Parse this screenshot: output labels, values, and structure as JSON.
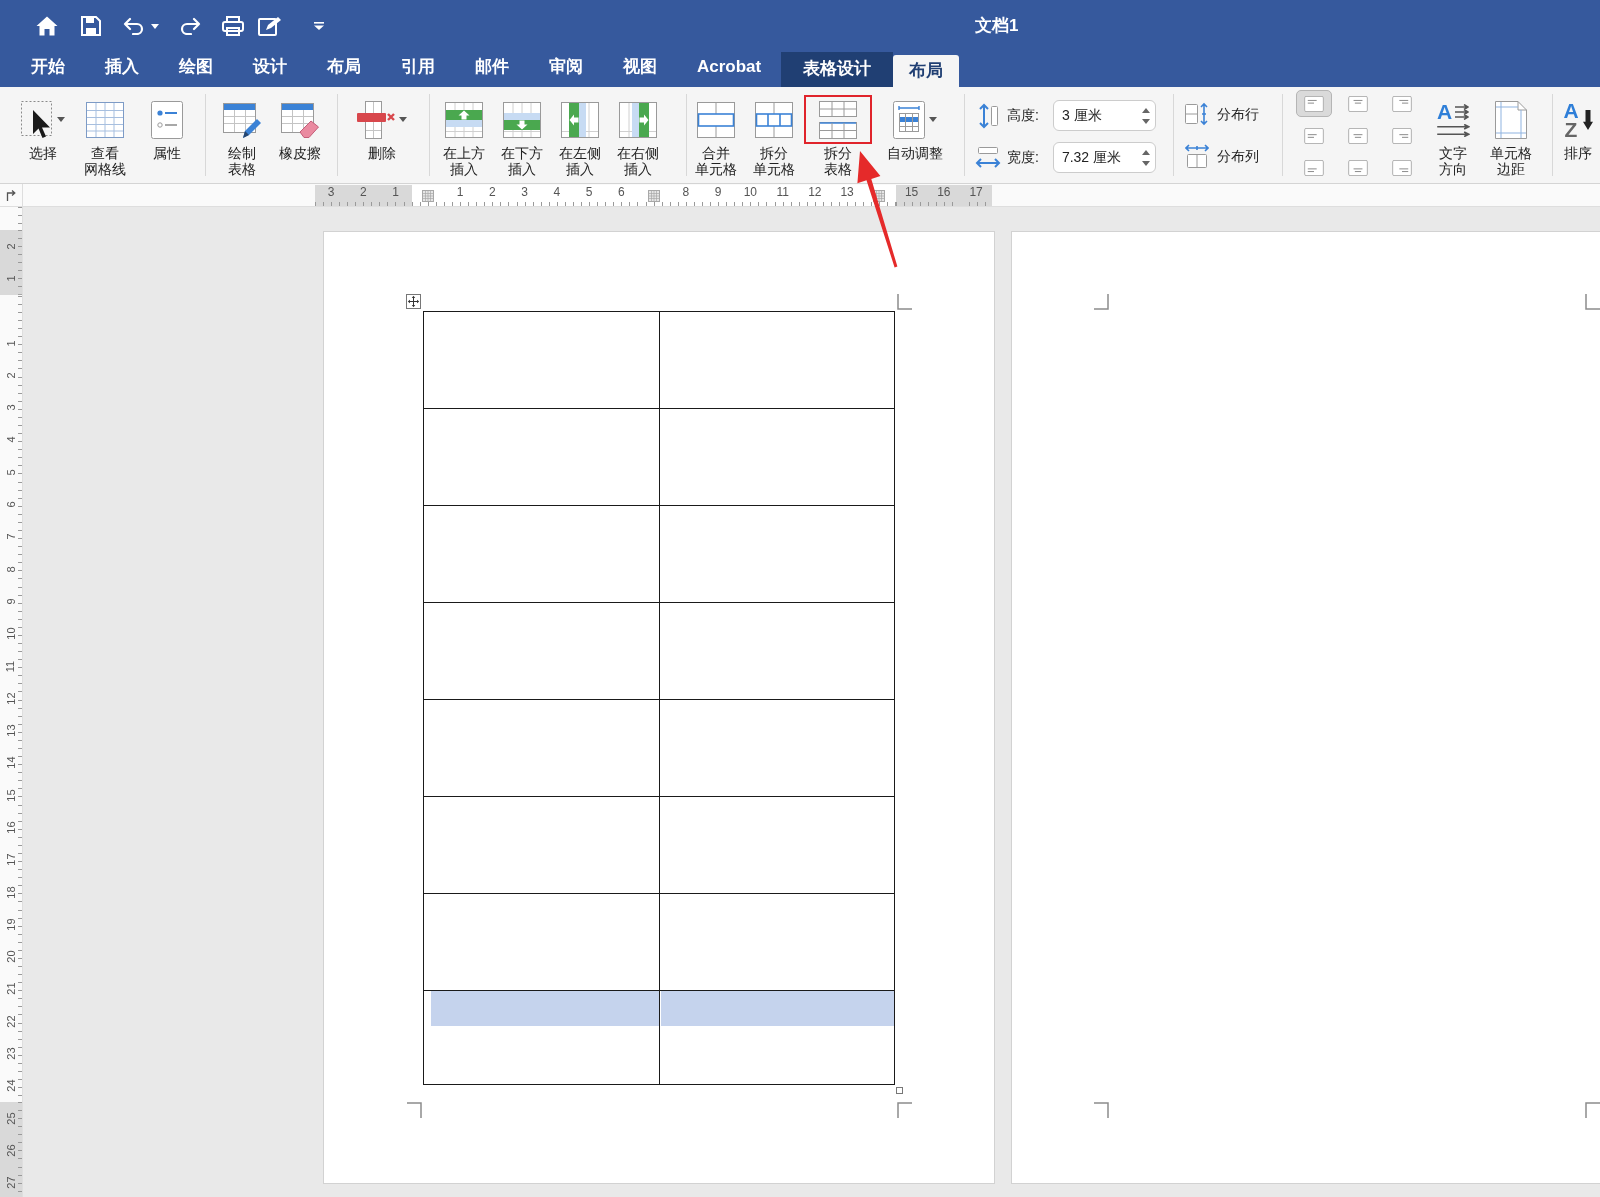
{
  "window": {
    "title": "文档1"
  },
  "tabs": [
    {
      "label": "开始",
      "selected": false,
      "contextual": false
    },
    {
      "label": "插入",
      "selected": false,
      "contextual": false
    },
    {
      "label": "绘图",
      "selected": false,
      "contextual": false
    },
    {
      "label": "设计",
      "selected": false,
      "contextual": false
    },
    {
      "label": "布局",
      "selected": false,
      "contextual": false
    },
    {
      "label": "引用",
      "selected": false,
      "contextual": false
    },
    {
      "label": "邮件",
      "selected": false,
      "contextual": false
    },
    {
      "label": "审阅",
      "selected": false,
      "contextual": false
    },
    {
      "label": "视图",
      "selected": false,
      "contextual": false
    },
    {
      "label": "Acrobat",
      "selected": false,
      "contextual": false
    },
    {
      "label": "表格设计",
      "selected": false,
      "contextual": true
    },
    {
      "label": "布局",
      "selected": true,
      "contextual": true
    }
  ],
  "ribbon": {
    "groups": [
      {
        "items": [
          {
            "kind": "button",
            "label": "选择",
            "dropdown": true,
            "highlighted": false
          },
          {
            "kind": "button",
            "label": "查看网格线",
            "dropdown": false,
            "highlighted": false
          },
          {
            "kind": "button",
            "label": "属性",
            "dropdown": false,
            "highlighted": false
          }
        ]
      },
      {
        "items": [
          {
            "kind": "button",
            "label": "绘制表格",
            "dropdown": false,
            "highlighted": false
          },
          {
            "kind": "button",
            "label": "橡皮擦",
            "dropdown": false,
            "highlighted": false
          }
        ]
      },
      {
        "items": [
          {
            "kind": "button",
            "label": "删除",
            "dropdown": true,
            "highlighted": false
          }
        ]
      },
      {
        "items": [
          {
            "kind": "button",
            "label": "在上方插入",
            "dropdown": false,
            "highlighted": false
          },
          {
            "kind": "button",
            "label": "在下方插入",
            "dropdown": false,
            "highlighted": false
          },
          {
            "kind": "button",
            "label": "在左侧插入",
            "dropdown": false,
            "highlighted": false
          },
          {
            "kind": "button",
            "label": "在右侧插入",
            "dropdown": false,
            "highlighted": false
          }
        ]
      },
      {
        "items": [
          {
            "kind": "button",
            "label": "合并单元格",
            "dropdown": false,
            "highlighted": false
          },
          {
            "kind": "button",
            "label": "拆分单元格",
            "dropdown": false,
            "highlighted": false
          },
          {
            "kind": "button",
            "label": "拆分表格",
            "dropdown": false,
            "highlighted": true
          },
          {
            "kind": "button",
            "label": "自动调整",
            "dropdown": true,
            "highlighted": false
          }
        ]
      },
      {
        "items": [
          {
            "kind": "spinner",
            "label": "高度:",
            "value": "3 厘米"
          },
          {
            "kind": "spinner",
            "label": "宽度:",
            "value": "7.32 厘米"
          }
        ]
      },
      {
        "items": [
          {
            "kind": "small",
            "label": "分布行"
          },
          {
            "kind": "small",
            "label": "分布列"
          }
        ]
      },
      {
        "items": [
          {
            "kind": "align_grid",
            "cells": [
              {
                "selected": true
              },
              {
                "selected": false
              },
              {
                "selected": false
              },
              {
                "selected": false
              },
              {
                "selected": false
              },
              {
                "selected": false
              },
              {
                "selected": false
              },
              {
                "selected": false
              },
              {
                "selected": false
              }
            ]
          },
          {
            "kind": "button",
            "label": "文字方向",
            "glyphs": [
              "A"
            ],
            "dropdown": false,
            "highlighted": false
          },
          {
            "kind": "button",
            "label": "单元格边距",
            "dropdown": false,
            "highlighted": false
          }
        ]
      },
      {
        "items": [
          {
            "kind": "button",
            "label": "排序",
            "glyphs": [
              "A",
              "Z"
            ],
            "dropdown": false,
            "highlighted": false
          }
        ]
      }
    ]
  },
  "rulers": {
    "horizontal": [
      {
        "kind": "margin",
        "labels": [
          "3",
          "2",
          "1"
        ]
      },
      {
        "kind": "marker"
      },
      {
        "kind": "text",
        "labels": [
          "1",
          "2",
          "3",
          "4",
          "5",
          "6"
        ]
      },
      {
        "kind": "marker"
      },
      {
        "kind": "text",
        "labels": [
          "8",
          "9",
          "10",
          "11",
          "12",
          "13"
        ]
      },
      {
        "kind": "marker"
      },
      {
        "kind": "margin",
        "labels": [
          "15",
          "16",
          "17"
        ]
      }
    ],
    "vertical": [
      {
        "kind": "margin",
        "labels": [
          "2",
          "1"
        ]
      },
      {
        "kind": "blank"
      },
      {
        "kind": "text",
        "labels": [
          "1",
          "2",
          "3",
          "4",
          "5",
          "6",
          "7",
          "8",
          "9",
          "10",
          "11",
          "12",
          "13",
          "14",
          "15",
          "16",
          "17",
          "18",
          "19",
          "20",
          "21",
          "22",
          "23",
          "24"
        ]
      },
      {
        "kind": "margin",
        "labels": [
          "25",
          "26",
          "27"
        ]
      }
    ]
  },
  "table": {
    "rows": [
      {
        "cells": [
          {
            "selected": false
          },
          {
            "selected": false
          }
        ]
      },
      {
        "cells": [
          {
            "selected": false
          },
          {
            "selected": false
          }
        ]
      },
      {
        "cells": [
          {
            "selected": false
          },
          {
            "selected": false
          }
        ]
      },
      {
        "cells": [
          {
            "selected": false
          },
          {
            "selected": false
          }
        ]
      },
      {
        "cells": [
          {
            "selected": false
          },
          {
            "selected": false
          }
        ]
      },
      {
        "cells": [
          {
            "selected": false
          },
          {
            "selected": false
          }
        ]
      },
      {
        "cells": [
          {
            "selected": false
          },
          {
            "selected": false
          }
        ]
      },
      {
        "cells": [
          {
            "selected": true
          },
          {
            "selected": true
          }
        ]
      }
    ]
  }
}
